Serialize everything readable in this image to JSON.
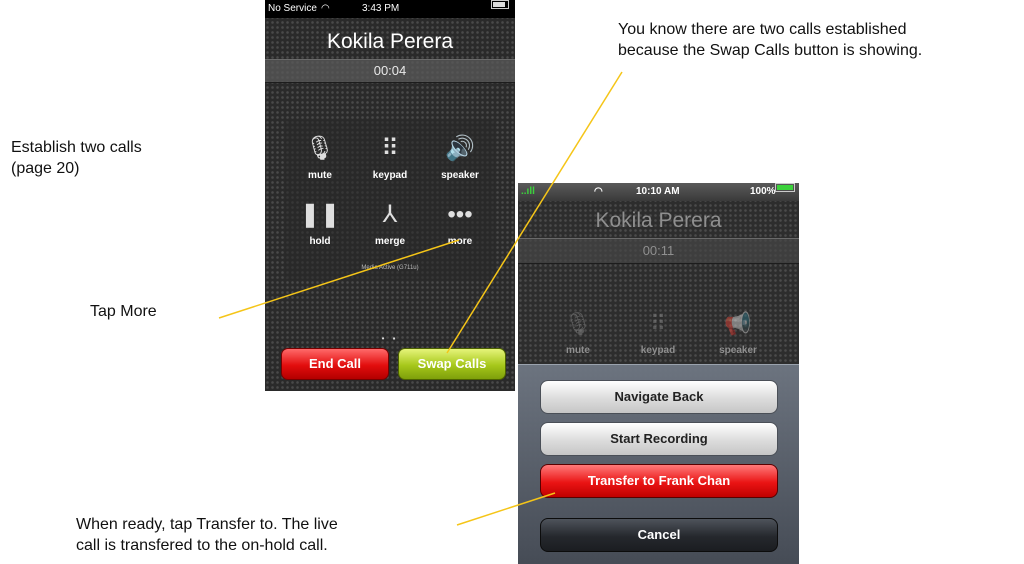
{
  "annotations": {
    "establish": [
      "Establish two calls",
      "(page 20)"
    ],
    "tap_more": "Tap More",
    "swap_note": [
      "You know there are two calls established",
      "because the Swap Calls button is showing."
    ],
    "transfer_note": [
      "When ready, tap Transfer to. The live",
      "call is transfered to the on-hold call."
    ]
  },
  "phone1": {
    "status": {
      "carrier": "No Service",
      "time": "3:43 PM"
    },
    "caller": "Kokila Perera",
    "timer": "00:04",
    "controls": [
      {
        "label": "mute",
        "icon": "microphone-muted-icon",
        "glyph": "🎙"
      },
      {
        "label": "keypad",
        "icon": "keypad-icon",
        "glyph": "⠿"
      },
      {
        "label": "speaker",
        "icon": "speaker-icon",
        "glyph": "🔊"
      },
      {
        "label": "hold",
        "icon": "pause-icon",
        "glyph": "❚❚"
      },
      {
        "label": "merge",
        "icon": "merge-icon",
        "glyph": "⅄"
      },
      {
        "label": "more",
        "icon": "more-icon",
        "glyph": "•••"
      }
    ],
    "media_status": "Media Active (G711u)",
    "end_call": "End Call",
    "swap_calls": "Swap Calls"
  },
  "phone2": {
    "status": {
      "signal": "..ıll",
      "time": "10:10 AM",
      "battery": "100%"
    },
    "caller": "Kokila Perera",
    "timer": "00:11",
    "dim_controls": [
      {
        "label": "mute",
        "icon": "microphone-muted-icon",
        "glyph": "🎙"
      },
      {
        "label": "keypad",
        "icon": "keypad-icon",
        "glyph": "⠿"
      },
      {
        "label": "speaker",
        "icon": "megaphone-icon",
        "glyph": "📢"
      }
    ],
    "sheet": {
      "navigate_back": "Navigate Back",
      "start_recording": "Start Recording",
      "transfer": "Transfer to Frank Chan",
      "cancel": "Cancel"
    }
  },
  "colors": {
    "leader_line": "#f5c518",
    "end_call": "#e20d0d",
    "swap_calls": "#a6c71a",
    "transfer": "#ea1414"
  }
}
